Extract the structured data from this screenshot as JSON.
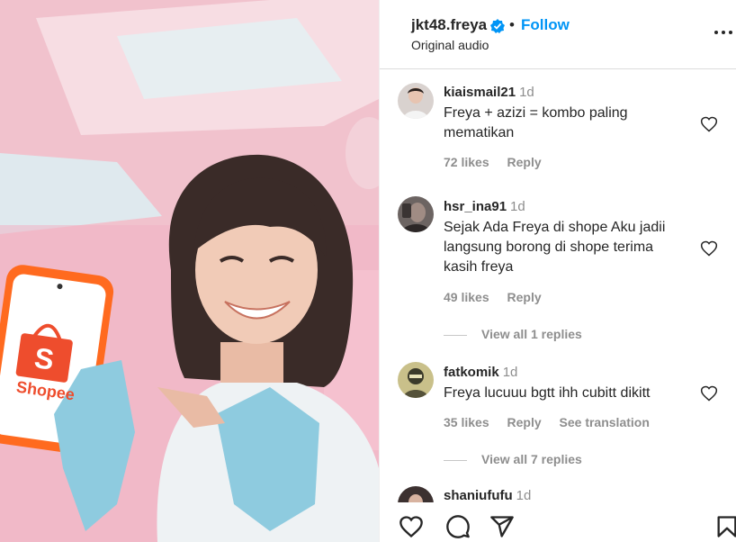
{
  "media": {
    "brand_logo_text": "Shopee"
  },
  "header": {
    "username": "jkt48.freya",
    "separator": "•",
    "follow_label": "Follow",
    "audio_label": "Original audio"
  },
  "comments": [
    {
      "user": "kiaismail21",
      "time": "1d",
      "text": "Freya + azizi = kombo paling mematikan",
      "likes": "72 likes",
      "reply": "Reply"
    },
    {
      "user": "hsr_ina91",
      "time": "1d",
      "text": "Sejak Ada Freya di shope Aku jadii langsung borong di shope terima kasih freya",
      "likes": "49 likes",
      "reply": "Reply",
      "view_replies": "View all 1 replies"
    },
    {
      "user": "fatkomik",
      "time": "1d",
      "text": "Freya lucuuu bgtt ihh cubitt dikitt",
      "likes": "35 likes",
      "reply": "Reply",
      "translate": "See translation",
      "view_replies": "View all 7 replies"
    },
    {
      "user": "shaniufufu",
      "time": "1d"
    }
  ],
  "actions": [
    "heart-icon",
    "comment-icon",
    "share-icon",
    "bookmark-icon"
  ],
  "colors": {
    "accent": "#0095f6",
    "muted": "#8e8e8e",
    "brand": "#ee4d2d"
  }
}
